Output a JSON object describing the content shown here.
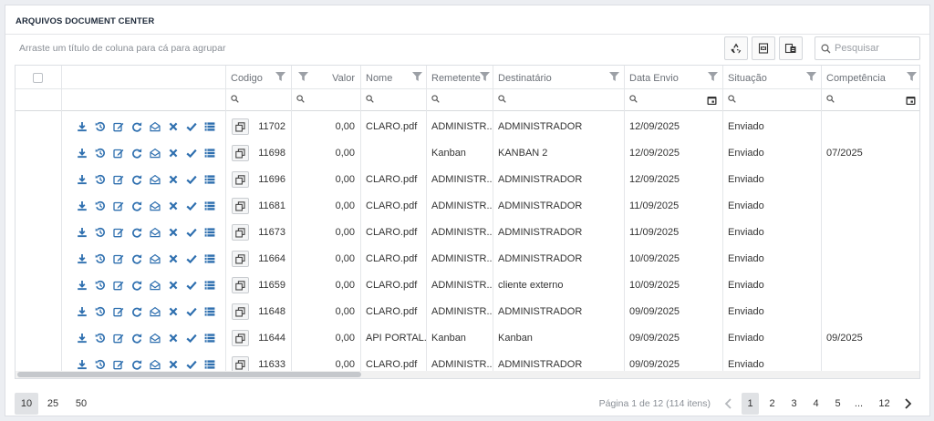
{
  "title": "ARQUIVOS DOCUMENT CENTER",
  "group_hint": "Arraste um título de coluna para cá para agrupar",
  "search": {
    "placeholder": "Pesquisar"
  },
  "columns": {
    "codigo": "Codigo",
    "valor": "Valor",
    "nome": "Nome",
    "remetente": "Remetente",
    "destinatario": "Destinatário",
    "data_envio": "Data Envio",
    "situacao": "Situação",
    "competencia": "Competência"
  },
  "rows": [
    {
      "codigo": "11702",
      "valor": "0,00",
      "nome": "CLARO.pdf",
      "remetente": "ADMINISTR...",
      "destinatario": "ADMINISTRADOR",
      "data_envio": "12/09/2025",
      "situacao": "Enviado",
      "competencia": ""
    },
    {
      "codigo": "11698",
      "valor": "0,00",
      "nome": "",
      "remetente": "Kanban",
      "destinatario": "KANBAN 2",
      "data_envio": "12/09/2025",
      "situacao": "Enviado",
      "competencia": "07/2025"
    },
    {
      "codigo": "11696",
      "valor": "0,00",
      "nome": "CLARO.pdf",
      "remetente": "ADMINISTR...",
      "destinatario": "ADMINISTRADOR",
      "data_envio": "12/09/2025",
      "situacao": "Enviado",
      "competencia": ""
    },
    {
      "codigo": "11681",
      "valor": "0,00",
      "nome": "CLARO.pdf",
      "remetente": "ADMINISTR...",
      "destinatario": "ADMINISTRADOR",
      "data_envio": "11/09/2025",
      "situacao": "Enviado",
      "competencia": ""
    },
    {
      "codigo": "11673",
      "valor": "0,00",
      "nome": "CLARO.pdf",
      "remetente": "ADMINISTR...",
      "destinatario": "ADMINISTRADOR",
      "data_envio": "11/09/2025",
      "situacao": "Enviado",
      "competencia": ""
    },
    {
      "codigo": "11664",
      "valor": "0,00",
      "nome": "CLARO.pdf",
      "remetente": "ADMINISTR...",
      "destinatario": "ADMINISTRADOR",
      "data_envio": "10/09/2025",
      "situacao": "Enviado",
      "competencia": ""
    },
    {
      "codigo": "11659",
      "valor": "0,00",
      "nome": "CLARO.pdf",
      "remetente": "ADMINISTR...",
      "destinatario": "cliente externo",
      "data_envio": "10/09/2025",
      "situacao": "Enviado",
      "competencia": ""
    },
    {
      "codigo": "11648",
      "valor": "0,00",
      "nome": "CLARO.pdf",
      "remetente": "ADMINISTR...",
      "destinatario": "ADMINISTRADOR",
      "data_envio": "09/09/2025",
      "situacao": "Enviado",
      "competencia": ""
    },
    {
      "codigo": "11644",
      "valor": "0,00",
      "nome": "API PORTAL...",
      "remetente": "Kanban",
      "destinatario": "Kanban",
      "data_envio": "09/09/2025",
      "situacao": "Enviado",
      "competencia": "09/2025"
    },
    {
      "codigo": "11633",
      "valor": "0,00",
      "nome": "CLARO.pdf",
      "remetente": "ADMINISTR...",
      "destinatario": "ADMINISTRADOR",
      "data_envio": "09/09/2025",
      "situacao": "Enviado",
      "competencia": ""
    }
  ],
  "row_actions": [
    "download-icon",
    "history-icon",
    "edit-icon",
    "refresh-icon",
    "envelope-open-icon",
    "close-icon",
    "check-icon",
    "list-icon"
  ],
  "toolbar_icons": [
    "recycle-icon",
    "excel-export-icon",
    "column-chooser-icon"
  ],
  "pager": {
    "sizes": [
      "10",
      "25",
      "50"
    ],
    "selected_size": "10",
    "info": "Página 1 de 12 (114 itens)",
    "pages": [
      "1",
      "2",
      "3",
      "4",
      "5"
    ],
    "current_page": "1",
    "ellipsis": "...",
    "last_page": "12"
  },
  "colors": {
    "action_icon": "#2e6faf",
    "title": "#1e2a3a",
    "muted_text": "#8a8f96"
  }
}
